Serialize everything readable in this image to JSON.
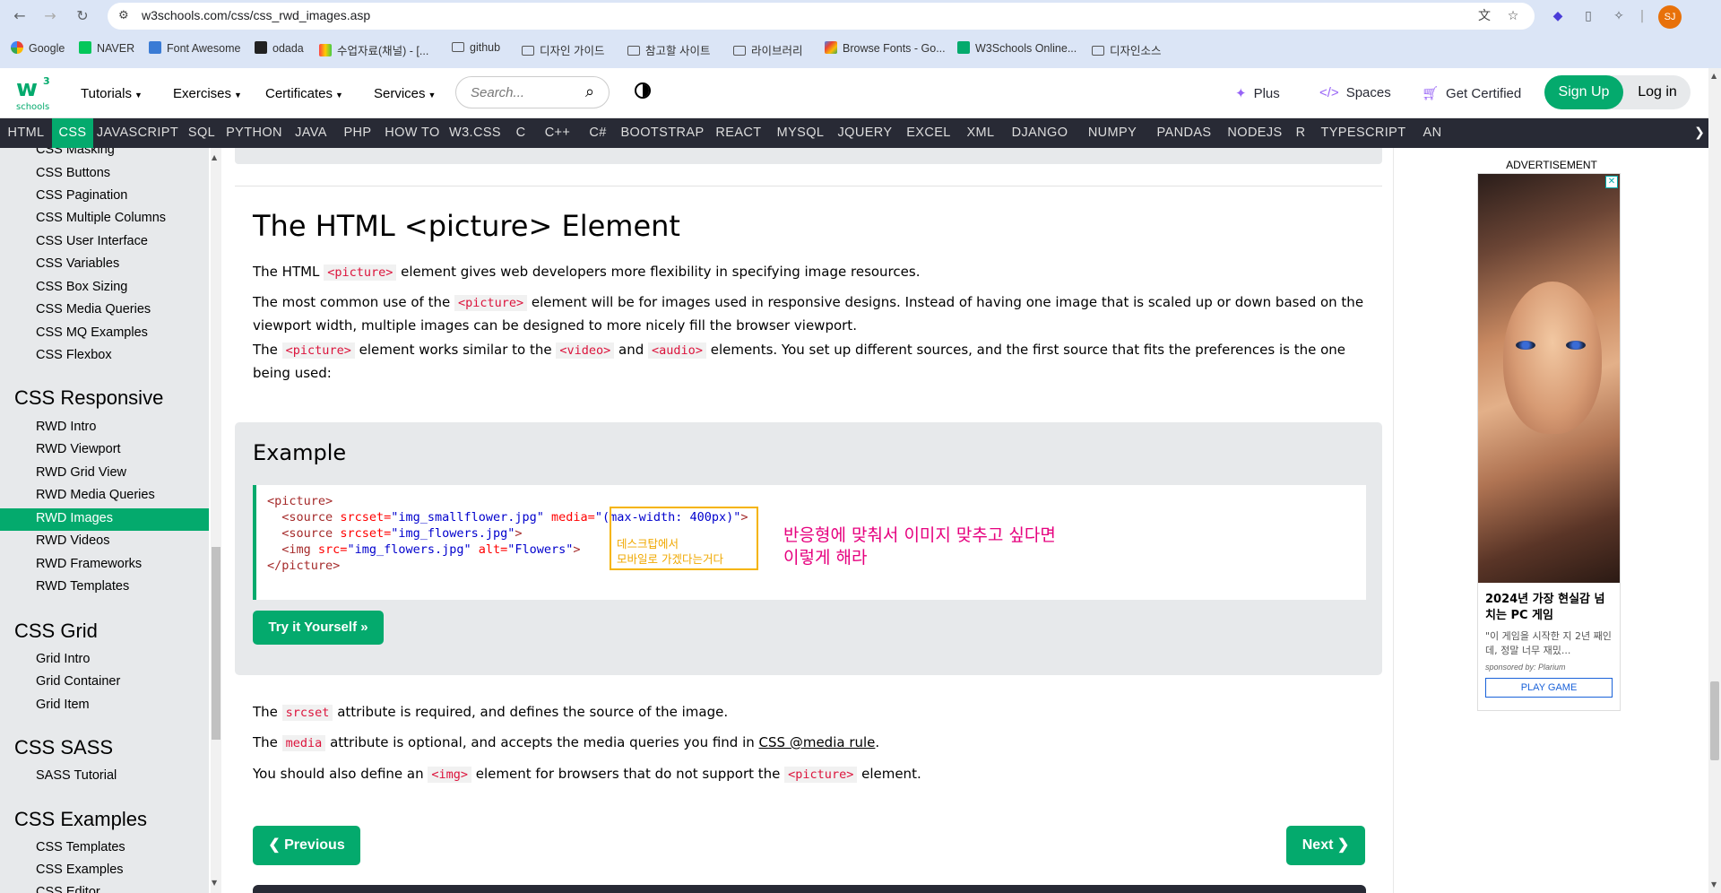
{
  "browser": {
    "url": "w3schools.com/css/css_rwd_images.asp",
    "profile_initials": "SJ",
    "bookmarks": [
      "Google",
      "NAVER",
      "Font Awesome",
      "odada",
      "수업자료(채널) - [...",
      "github",
      "디자인 가이드",
      "참고할 사이트",
      "라이브러리",
      "Browse Fonts - Go...",
      "W3Schools Online...",
      "디자인소스"
    ]
  },
  "topnav": {
    "logo_text": "w",
    "logo_sup": "3",
    "logo_sub": "schools",
    "menu": [
      "Tutorials",
      "Exercises",
      "Certificates",
      "Services"
    ],
    "search_placeholder": "Search...",
    "plus": "Plus",
    "spaces": "Spaces",
    "get_certified": "Get Certified",
    "signup": "Sign Up",
    "login": "Log in"
  },
  "subnav": {
    "items": [
      "HTML",
      "CSS",
      "JAVASCRIPT",
      "SQL",
      "PYTHON",
      "JAVA",
      "PHP",
      "HOW TO",
      "W3.CSS",
      "C",
      "C++",
      "C#",
      "BOOTSTRAP",
      "REACT",
      "MYSQL",
      "JQUERY",
      "EXCEL",
      "XML",
      "DJANGO",
      "NUMPY",
      "PANDAS",
      "NODEJS",
      "R",
      "TYPESCRIPT",
      "AN"
    ],
    "active": "CSS"
  },
  "sidebar": {
    "items_top": [
      "CSS Masking",
      "CSS Buttons",
      "CSS Pagination",
      "CSS Multiple Columns",
      "CSS User Interface",
      "CSS Variables",
      "CSS Box Sizing",
      "CSS Media Queries",
      "CSS MQ Examples",
      "CSS Flexbox"
    ],
    "h_responsive": "CSS Responsive",
    "items_responsive": [
      "RWD Intro",
      "RWD Viewport",
      "RWD Grid View",
      "RWD Media Queries",
      "RWD Images",
      "RWD Videos",
      "RWD Frameworks",
      "RWD Templates"
    ],
    "active": "RWD Images",
    "h_grid": "CSS Grid",
    "items_grid": [
      "Grid Intro",
      "Grid Container",
      "Grid Item"
    ],
    "h_sass": "CSS SASS",
    "items_sass": [
      "SASS Tutorial"
    ],
    "h_examples": "CSS Examples",
    "items_examples": [
      "CSS Templates",
      "CSS Examples",
      "CSS Editor"
    ]
  },
  "content": {
    "title": "The HTML <picture> Element",
    "p1_a": "The HTML ",
    "p1_code": "<picture>",
    "p1_b": " element gives web developers more flexibility in specifying image resources.",
    "p2_a": "The most common use of the ",
    "p2_code": "<picture>",
    "p2_b": " element will be for images used in responsive designs. Instead of having one image that is scaled up or down based on the viewport width, multiple images can be designed to more nicely fill the browser viewport.",
    "p3_a": "The ",
    "p3_code1": "<picture>",
    "p3_b": " element works similar to the ",
    "p3_code2": "<video>",
    "p3_c": " and ",
    "p3_code3": "<audio>",
    "p3_d": " elements. You set up different sources, and the first source that fits the preferences is the one being used:",
    "example_title": "Example",
    "code_lines": [
      "<picture>",
      "  <source srcset=\"img_smallflower.jpg\" media=\"(max-width: 400px)\">",
      "  <source srcset=\"img_flowers.jpg\">",
      "  <img src=\"img_flowers.jpg\" alt=\"Flowers\">",
      "</picture>"
    ],
    "try_it": "Try it Yourself »",
    "annotation_small": [
      "데스크탑에서",
      "모바일로 가겠다는거다"
    ],
    "annotation_big": [
      "반응형에 맞춰서 이미지 맞추고 싶다면",
      "이렇게 해라"
    ],
    "p4_a": "The ",
    "p4_code": "srcset",
    "p4_b": " attribute is required, and defines the source of the image.",
    "p5_a": "The ",
    "p5_code": "media",
    "p5_b": " attribute is optional, and accepts the media queries you find in ",
    "p5_link": "CSS @media rule",
    "p5_c": ".",
    "p6_a": "You should also define an ",
    "p6_code1": "<img>",
    "p6_b": " element for browsers that do not support the ",
    "p6_code2": "<picture>",
    "p6_c": " element.",
    "prev": "❮ Previous",
    "next": "Next ❯"
  },
  "ad": {
    "label": "ADVERTISEMENT",
    "headline": "2024년 가장 현실감 넘치는 PC 게임",
    "body": "\"이 게임을 시작한 지 2년 째인데, 정말 너무 재밌...",
    "sponsor": "sponsored by: Plarium",
    "cta": "PLAY GAME"
  },
  "colors": {
    "accent": "#04aa6d",
    "subnav_bg": "#282a35",
    "sidebar_bg": "#e7e9eb",
    "code_red": "#dc143c",
    "annotation_yellow": "#f5b400",
    "annotation_pink": "#e6007e"
  }
}
